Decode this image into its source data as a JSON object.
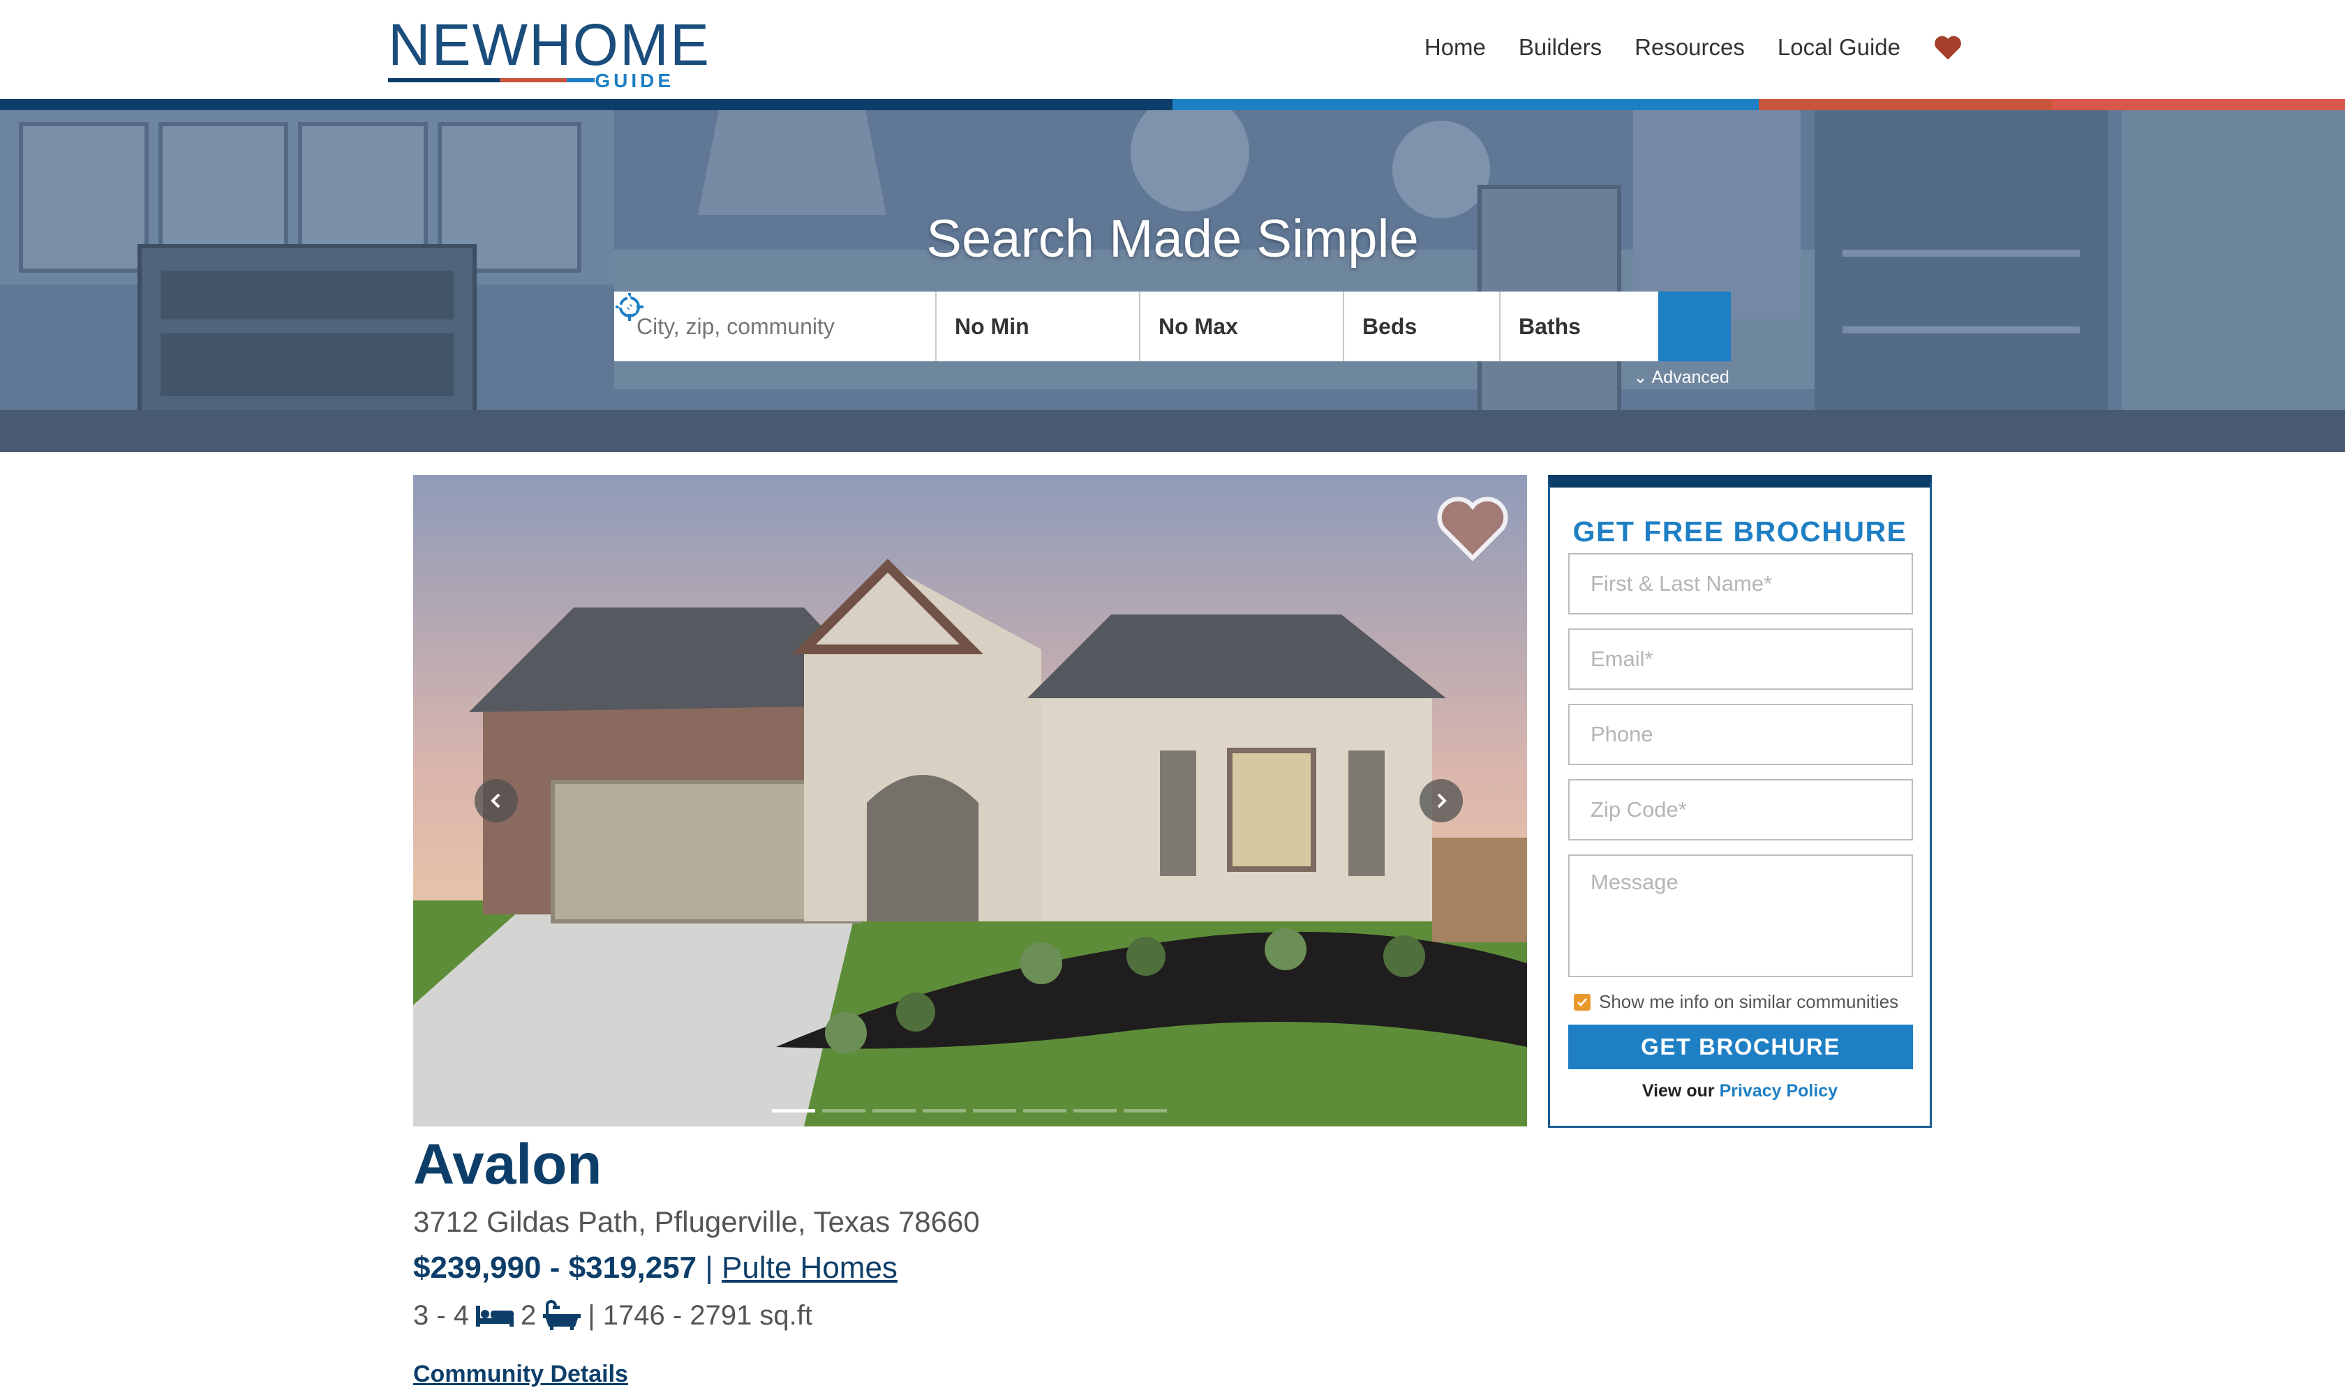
{
  "colors": {
    "navy": "#0d3e69",
    "blue": "#1e7fc4",
    "red": "#c7553c",
    "heart": "#a5412a",
    "checkbox": "#e8992c"
  },
  "header": {
    "logo": {
      "main": "NEWHOME",
      "sub": "GUIDE"
    },
    "nav": [
      {
        "label": "Home"
      },
      {
        "label": "Builders"
      },
      {
        "label": "Resources"
      },
      {
        "label": "Local Guide"
      }
    ],
    "favorites_icon": "heart-icon"
  },
  "hero": {
    "title": "Search Made Simple",
    "search": {
      "location_placeholder": "City, zip, community",
      "min_price": "No Min",
      "max_price": "No Max",
      "beds": "Beds",
      "baths": "Baths",
      "search_icon": "search-icon"
    },
    "advanced_label": "Advanced"
  },
  "gallery": {
    "slide_count": 8,
    "active_slide": 1,
    "favorite_icon": "heart-icon"
  },
  "listing": {
    "name": "Avalon",
    "address": "3712 Gildas Path, Pflugerville, Texas 78660",
    "price_range": "$239,990 - $319,257",
    "separator": "|",
    "builder": "Pulte Homes",
    "beds": "3 - 4",
    "baths": "2",
    "sqft": "| 1746 - 2791 sq.ft",
    "community_link": "Community Details"
  },
  "brochure": {
    "title": "GET FREE BROCHURE",
    "fields": {
      "name_placeholder": "First & Last Name*",
      "email_placeholder": "Email*",
      "phone_placeholder": "Phone",
      "zip_placeholder": "Zip Code*",
      "message_placeholder": "Message"
    },
    "similar_checkbox_label": "Show me info on similar communities",
    "similar_checked": true,
    "submit_label": "GET BROCHURE",
    "privacy_prefix": "View our",
    "privacy_link": "Privacy Policy"
  }
}
